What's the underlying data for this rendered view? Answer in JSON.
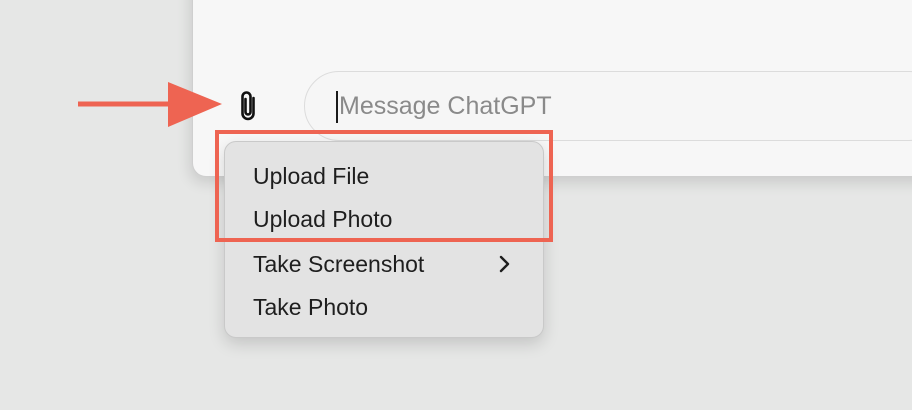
{
  "composer": {
    "placeholder": "Message ChatGPT",
    "attach_icon": "paperclip-icon"
  },
  "attach_menu": {
    "items": [
      {
        "label": "Upload File",
        "has_submenu": false
      },
      {
        "label": "Upload Photo",
        "has_submenu": false
      },
      {
        "label": "Take Screenshot",
        "has_submenu": true
      },
      {
        "label": "Take Photo",
        "has_submenu": false
      }
    ]
  },
  "annotation": {
    "highlight_color": "#ee6452",
    "arrow_color": "#ee6452",
    "highlighted_items": [
      "Upload File",
      "Upload Photo"
    ]
  }
}
